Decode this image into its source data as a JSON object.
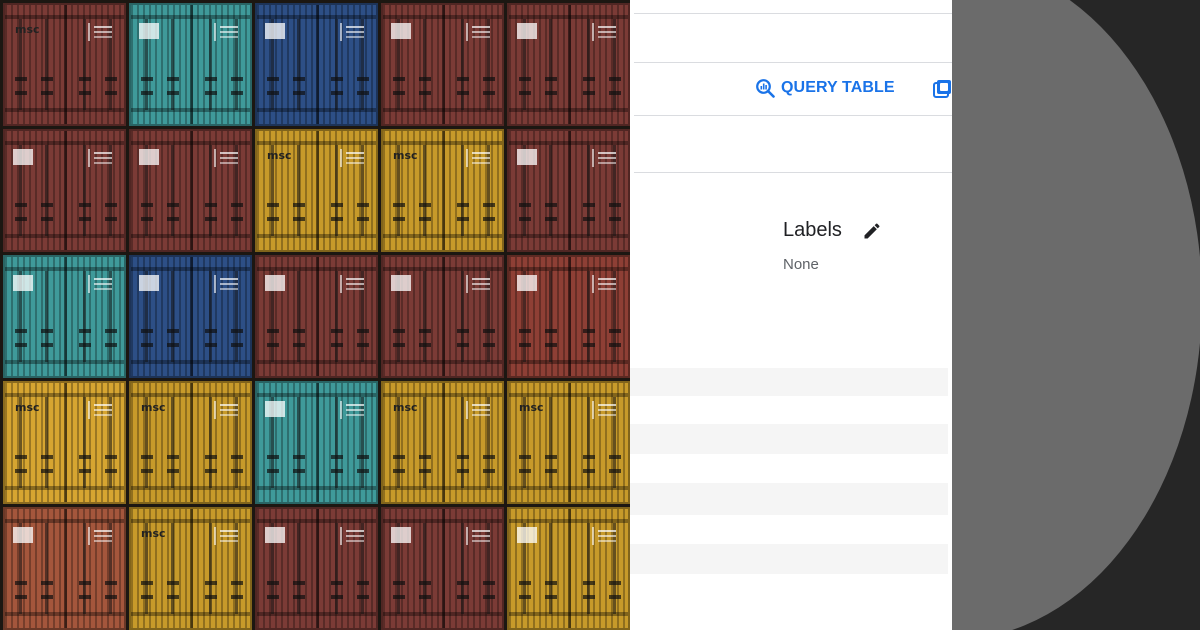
{
  "photo": {
    "alt_subject": "stacked shipping containers"
  },
  "toolbar": {
    "query_label": "QUERY TABLE",
    "query_icon": "query-search-icon",
    "second_action_icon": "copy-table-icon",
    "accent_color": "#1a73e8"
  },
  "labels": {
    "title": "Labels",
    "value": "None",
    "edit_icon": "pencil-icon"
  },
  "colors": {
    "panel_background": "#ffffff",
    "divider": "#dadce0",
    "stripe": "#f5f5f5",
    "backdrop": "#262626",
    "backdrop_circle": "#6b6b6b"
  }
}
